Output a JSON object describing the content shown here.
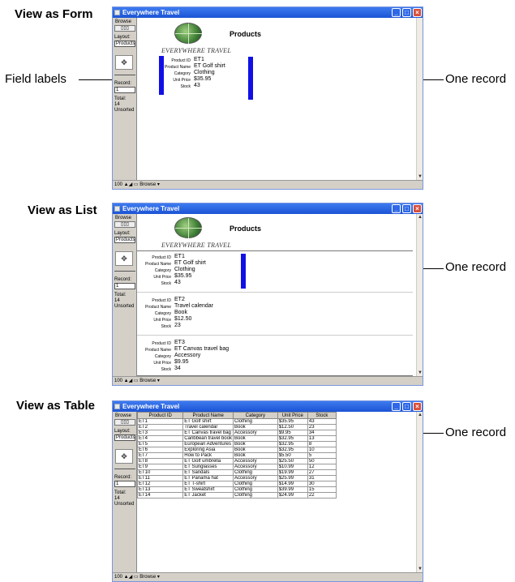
{
  "callouts": {
    "form_heading": "View as Form",
    "list_heading": "View as List",
    "table_heading": "View as Table",
    "field_labels": "Field labels",
    "one_record": "One record"
  },
  "window": {
    "title": "Everywhere Travel",
    "status": {
      "mode": "Browse",
      "layout_label": "Layout:",
      "layout_value": "Products",
      "record_label": "Record:",
      "record_value": "1",
      "total_label": "Total:",
      "total_value": "14",
      "sort_state": "Unsorted"
    },
    "bottom": {
      "zoom": "100",
      "mode": "Browse"
    }
  },
  "layout": {
    "brand": "EVERYWHERE TRAVEL",
    "title": "Products",
    "field_labels": [
      "Product ID",
      "Product Name",
      "Category",
      "Unit Price",
      "Stock"
    ]
  },
  "records": [
    [
      "ET1",
      "ET Golf shirt",
      "Clothing",
      "$35.95",
      "43"
    ],
    [
      "ET2",
      "Travel calendar",
      "Book",
      "$12.50",
      "23"
    ],
    [
      "ET3",
      "ET Canvas travel bag",
      "Accessory",
      "$9.95",
      "34"
    ]
  ],
  "table": {
    "columns": [
      "Product ID",
      "Product Name",
      "Category",
      "Unit Price",
      "Stock"
    ],
    "rows": [
      [
        "ET1",
        "ET Golf shirt",
        "Clothing",
        "$35.95",
        "43"
      ],
      [
        "ET2",
        "Travel calendar",
        "Book",
        "$12.50",
        "23"
      ],
      [
        "ET3",
        "ET Canvas travel bag",
        "Accessory",
        "$9.95",
        "34"
      ],
      [
        "ET4",
        "Caribbean travel book",
        "Book",
        "$32.95",
        "13"
      ],
      [
        "ET5",
        "European Adventures",
        "Book",
        "$32.95",
        "8"
      ],
      [
        "ET6",
        "Exploring Asia",
        "Book",
        "$32.95",
        "10"
      ],
      [
        "ET7",
        "How to Pack",
        "Book",
        "$5.50",
        "5"
      ],
      [
        "ET8",
        "ET Golf umbrella",
        "Accessory",
        "$25.50",
        "50"
      ],
      [
        "ET9",
        "ET Sunglasses",
        "Accessory",
        "$10.99",
        "12"
      ],
      [
        "ET10",
        "ET Sandals",
        "Clothing",
        "$19.99",
        "27"
      ],
      [
        "ET11",
        "ET Panama hat",
        "Accessory",
        "$25.99",
        "31"
      ],
      [
        "ET12",
        "ET T-shirt",
        "Clothing",
        "$14.99",
        "30"
      ],
      [
        "ET13",
        "ET Sweatshirt",
        "Clothing",
        "$39.99",
        "15"
      ],
      [
        "ET14",
        "ET Jacket",
        "Clothing",
        "$24.99",
        "22"
      ]
    ]
  },
  "colors": {
    "highlight_bar": "#1010e6",
    "titlebar": "#1c53d4"
  }
}
